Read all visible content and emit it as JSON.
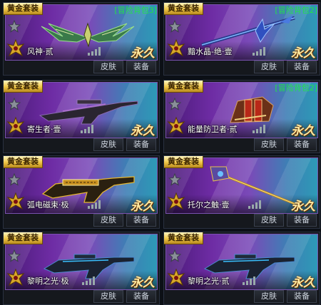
{
  "labels": {
    "badge": "黄金套装",
    "skin_button": "皮肤",
    "equip_button": "装备",
    "permanent": "永久"
  },
  "colors": {
    "badge_gold": "#f0c848",
    "backpack_green": "#22e04a",
    "card_purple": "#6e2ca4",
    "card_teal": "#2d9ab7"
  },
  "items": [
    {
      "name": "风神·贰",
      "backpack": "[冒险背包3]",
      "weapon_icon": "winged-blade-icon"
    },
    {
      "name": "黯水晶-绝·壹",
      "backpack": "[冒险背包2]",
      "weapon_icon": "crystal-spear-icon"
    },
    {
      "name": "寄生者·壹",
      "backpack": "",
      "weapon_icon": "sniper-rifle-icon"
    },
    {
      "name": "能量防卫者·贰",
      "backpack": "[冒险背包2]",
      "weapon_icon": "gauntlet-icon"
    },
    {
      "name": "弧电磁束·极",
      "backpack": "",
      "weapon_icon": "gold-rifle-icon"
    },
    {
      "name": "托尔之触·壹",
      "backpack": "",
      "weapon_icon": "hammer-staff-icon"
    },
    {
      "name": "黎明之光·极",
      "backpack": "",
      "weapon_icon": "dark-rifle-icon"
    },
    {
      "name": "黎明之光·贰",
      "backpack": "",
      "weapon_icon": "dark-rifle-icon"
    }
  ]
}
